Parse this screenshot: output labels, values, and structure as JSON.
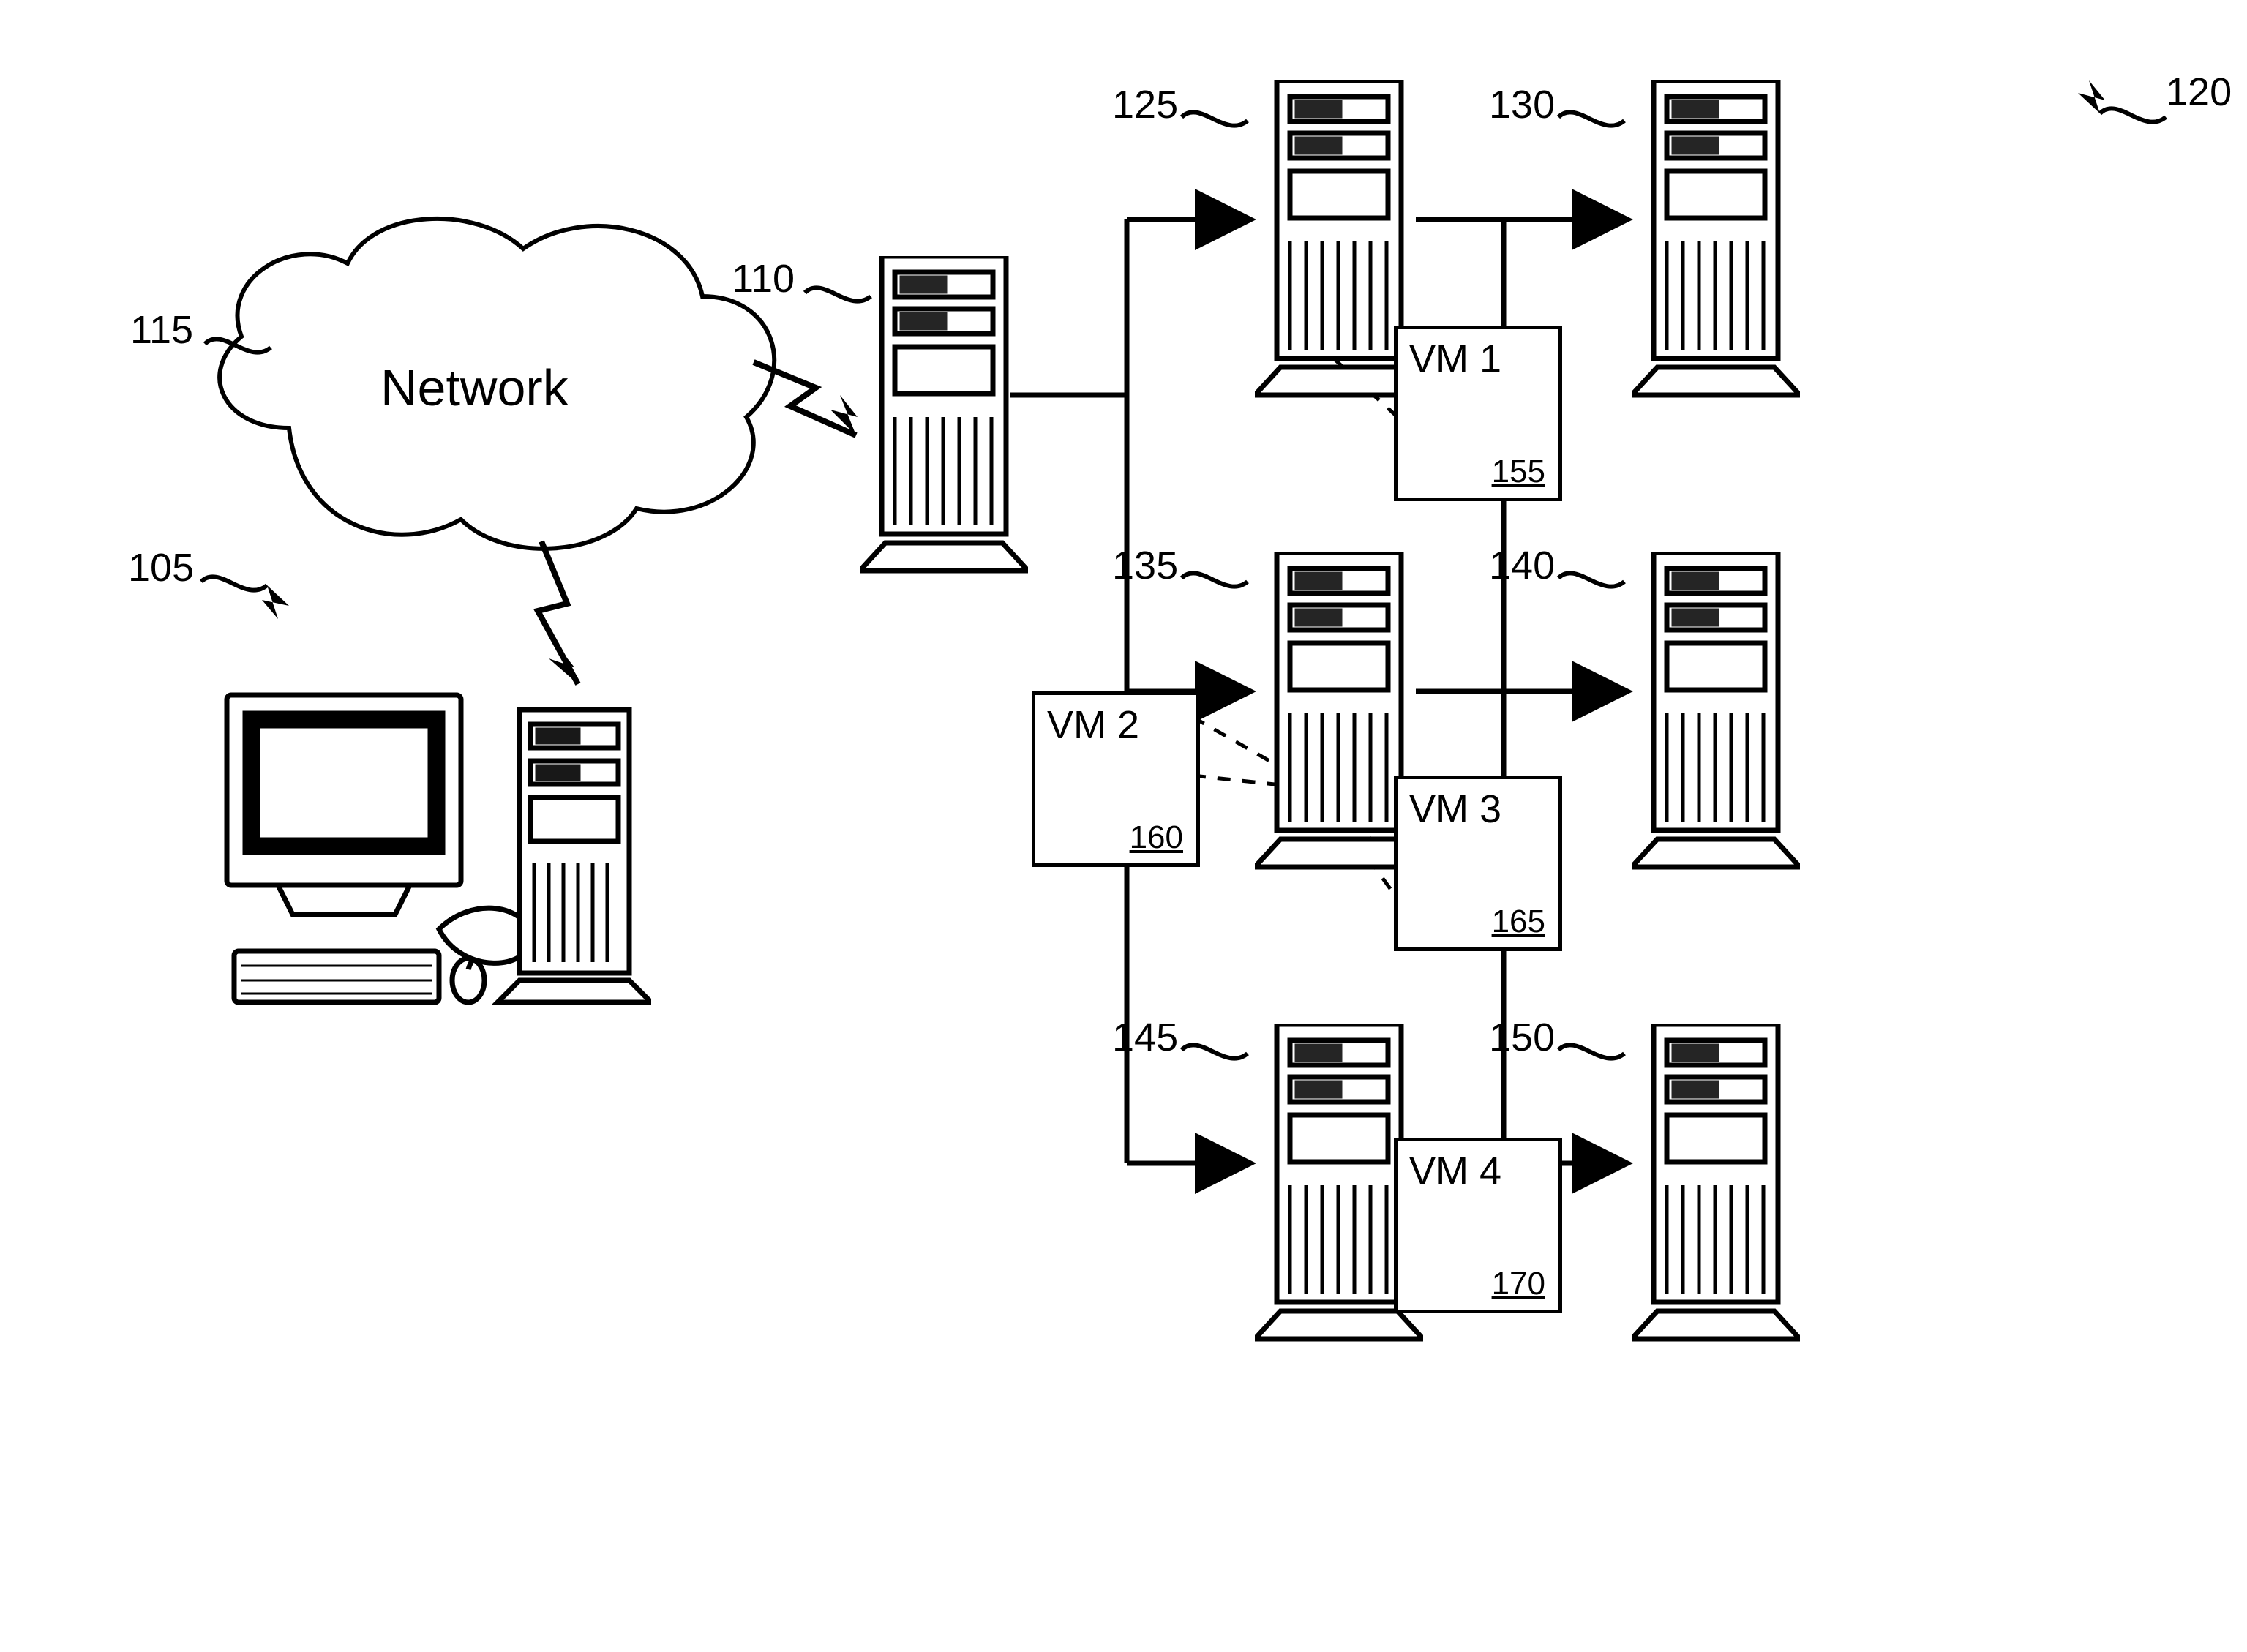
{
  "labels": {
    "network": "Network",
    "ref105": "105",
    "ref110": "110",
    "ref115": "115",
    "ref120": "120",
    "ref125": "125",
    "ref130": "130",
    "ref135": "135",
    "ref140": "140",
    "ref145": "145",
    "ref150": "150"
  },
  "vm": {
    "vm1": {
      "title": "VM 1",
      "ref": "155"
    },
    "vm2": {
      "title": "VM 2",
      "ref": "160"
    },
    "vm3": {
      "title": "VM 3",
      "ref": "165"
    },
    "vm4": {
      "title": "VM 4",
      "ref": "170"
    }
  }
}
